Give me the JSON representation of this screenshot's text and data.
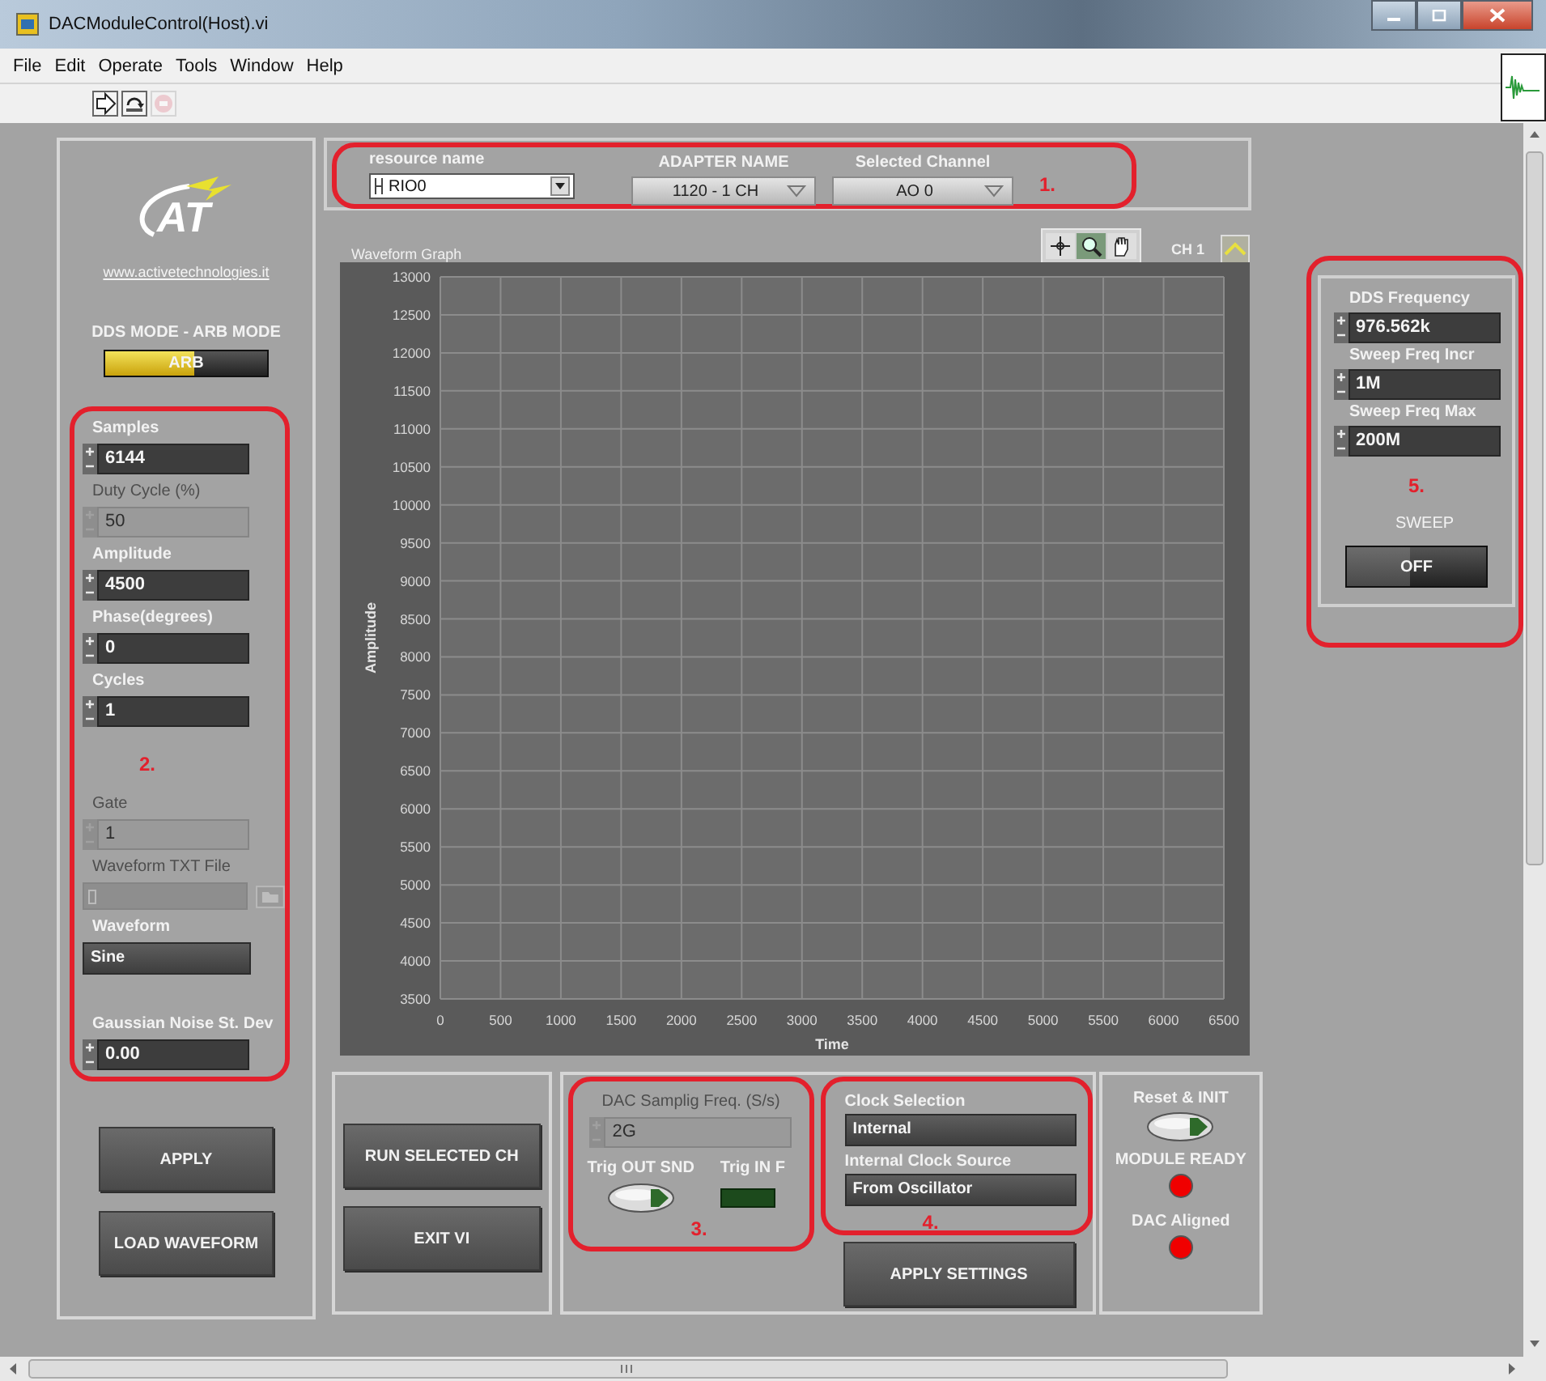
{
  "window": {
    "title": "DACModuleControl(Host).vi"
  },
  "menu": [
    "File",
    "Edit",
    "Operate",
    "Tools",
    "Window",
    "Help"
  ],
  "toolbar": [
    {
      "kind": "run",
      "disabled": false
    },
    {
      "kind": "run-continuous",
      "disabled": false
    },
    {
      "kind": "abort",
      "disabled": true
    }
  ],
  "logo": {
    "text": "AT",
    "link": "www.activetechnologies.it"
  },
  "mode_switch": {
    "label": "DDS MODE - ARB MODE",
    "text": "ARB",
    "on": true
  },
  "parameters": {
    "marker": "2.",
    "items": [
      {
        "kind": "numeric",
        "label": "Samples",
        "value": "6144",
        "disabled": false
      },
      {
        "kind": "numeric",
        "label": "Duty Cycle (%)",
        "value": "50",
        "disabled": true
      },
      {
        "kind": "numeric",
        "label": "Amplitude",
        "value": "4500",
        "disabled": false
      },
      {
        "kind": "numeric",
        "label": "Phase(degrees)",
        "value": "0",
        "disabled": false
      },
      {
        "kind": "numeric",
        "label": "Cycles",
        "value": "1",
        "disabled": false
      },
      {
        "kind": "marker"
      },
      {
        "kind": "numeric",
        "label": "Gate",
        "value": "1",
        "disabled": true
      },
      {
        "kind": "path",
        "label": "Waveform TXT File",
        "disabled": true
      },
      {
        "kind": "ring",
        "label": "Waveform",
        "value": "Sine",
        "disabled": false
      },
      {
        "kind": "numeric",
        "label": "Gaussian Noise St. Dev",
        "value": "0.00",
        "disabled": false
      }
    ]
  },
  "left_buttons": [
    "APPLY",
    "LOAD WAVEFORM"
  ],
  "hardware": {
    "marker": "1.",
    "resource": {
      "label": "resource name",
      "value": "RIO0"
    },
    "adapter": {
      "label": "ADAPTER NAME",
      "value": "1120 - 1 CH"
    },
    "channel": {
      "label": "Selected Channel",
      "value": "AO 0"
    }
  },
  "graph": {
    "title": "Waveform Graph",
    "legend": "CH 1",
    "chart_data": {
      "type": "line",
      "grid": true,
      "xlabel": "Time",
      "ylabel": "Amplitude",
      "xlim": [
        0,
        6500
      ],
      "ylim": [
        3500,
        13000
      ],
      "xticks": [
        0,
        500,
        1000,
        1500,
        2000,
        2500,
        3000,
        3500,
        4000,
        4500,
        5000,
        5500,
        6000,
        6500
      ],
      "yticks": [
        3500,
        4000,
        4500,
        5000,
        5500,
        6000,
        6500,
        7000,
        7500,
        8000,
        8500,
        9000,
        9500,
        10000,
        10500,
        11000,
        11500,
        12000,
        12500,
        13000
      ]
    }
  },
  "sweep_panel": {
    "marker": "5.",
    "fields": [
      {
        "label": "DDS Frequency",
        "value": "976.562k"
      },
      {
        "label": "Sweep Freq Incr",
        "value": "1M"
      },
      {
        "label": "Sweep Freq Max",
        "value": "200M"
      }
    ],
    "sweep": {
      "label": "SWEEP",
      "text": "OFF",
      "on": false
    }
  },
  "run_buttons": [
    "RUN SELECTED CH",
    "EXIT VI"
  ],
  "sampling": {
    "marker": "3.",
    "rate": {
      "label": "DAC Samplig Freq. (S/s)",
      "value": "2G",
      "disabled": true
    },
    "trig_out": {
      "label": "Trig OUT SND",
      "on": false
    },
    "trig_in": {
      "label": "Trig IN F",
      "on": false
    }
  },
  "clock": {
    "marker": "4.",
    "selection": {
      "label": "Clock Selection",
      "value": "Internal"
    },
    "source": {
      "label": "Internal Clock Source",
      "value": "From Oscillator"
    },
    "apply": "APPLY SETTINGS"
  },
  "status": {
    "reset": {
      "label": "Reset & INIT",
      "on": false
    },
    "leds": [
      {
        "label": "MODULE READY",
        "on": true
      },
      {
        "label": "DAC Aligned",
        "on": true
      }
    ]
  }
}
